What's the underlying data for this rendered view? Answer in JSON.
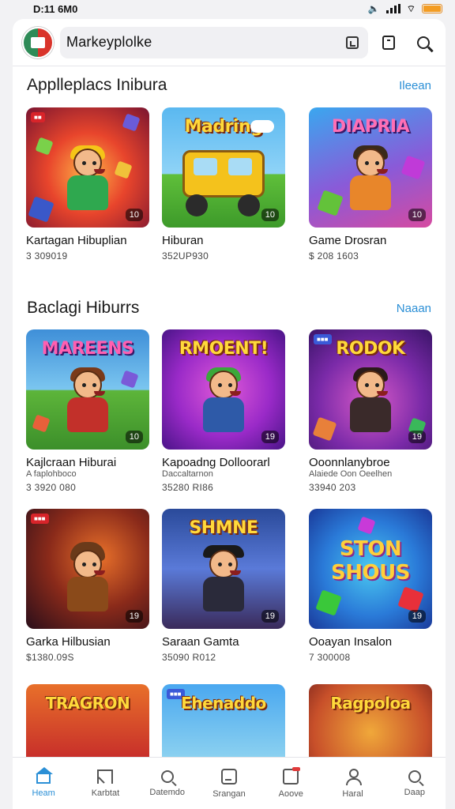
{
  "status_bar": {
    "time": "D:11 6M0"
  },
  "search": {
    "value": "Markeyplolke"
  },
  "sections": [
    {
      "title": "Applleplacs Inibura",
      "more": "Ileean",
      "items": [
        {
          "art_text": "",
          "title": "Kartagan Hibuplian",
          "subtitle": "",
          "price": "3 309019",
          "badge": "10"
        },
        {
          "art_text": "Madring",
          "title": "Hiburan",
          "subtitle": "",
          "price": "352UP930",
          "badge": "10"
        },
        {
          "art_text": "DIAPRIA",
          "title": "Game Drosran",
          "subtitle": "",
          "price": "$ 208 1603",
          "badge": "10"
        }
      ]
    },
    {
      "title": "Baclagi Hiburrs",
      "more": "Naaan",
      "items": [
        {
          "art_text": "MAREENS",
          "title": "Kajlcraan Hiburai",
          "subtitle": "A faplohboco",
          "price": "3 3920 080",
          "badge": "10"
        },
        {
          "art_text": "RMOENT!",
          "title": "Kapoadng Dolloorarl",
          "subtitle": "Daccaltarnon",
          "price": "35280 RI86",
          "badge": "19"
        },
        {
          "art_text": "RODOK",
          "title": "Ooonnlanybroe",
          "subtitle": "Alaiede Oon Oeelhen",
          "price": "33940 203",
          "badge": "19"
        }
      ]
    },
    {
      "title": "",
      "more": "",
      "items": [
        {
          "art_text": "",
          "title": "Garka Hilbusian",
          "subtitle": "",
          "price": "$1380.09S",
          "badge": "19"
        },
        {
          "art_text": "SHMNE",
          "title": "Saraan Gamta",
          "subtitle": "",
          "price": "35090 R012",
          "badge": "19"
        },
        {
          "art_text": "STON SHOUS",
          "title": "Ooayan Insalon",
          "subtitle": "",
          "price": "7 300008",
          "badge": "19"
        }
      ]
    },
    {
      "title": "",
      "more": "",
      "items": [
        {
          "art_text": "TRAGRON",
          "title": "",
          "subtitle": "",
          "price": "",
          "badge": ""
        },
        {
          "art_text": "Ehenaddo",
          "title": "",
          "subtitle": "",
          "price": "",
          "badge": ""
        },
        {
          "art_text": "Ragpoloa",
          "title": "",
          "subtitle": "",
          "price": "",
          "badge": ""
        }
      ]
    }
  ],
  "bottom_nav": [
    {
      "label": "Heam",
      "icon": "home-icon",
      "active": true
    },
    {
      "label": "Karbtat",
      "icon": "flag-icon",
      "active": false
    },
    {
      "label": "Datemdo",
      "icon": "search-icon",
      "active": false
    },
    {
      "label": "Srangan",
      "icon": "box-icon",
      "active": false
    },
    {
      "label": "Aoove",
      "icon": "message-icon",
      "active": false
    },
    {
      "label": "Haral",
      "icon": "user-icon",
      "active": false
    },
    {
      "label": "Daap",
      "icon": "search-icon",
      "active": false
    }
  ],
  "colors": {
    "accent": "#2b8fd6",
    "battery": "#f39c22"
  }
}
